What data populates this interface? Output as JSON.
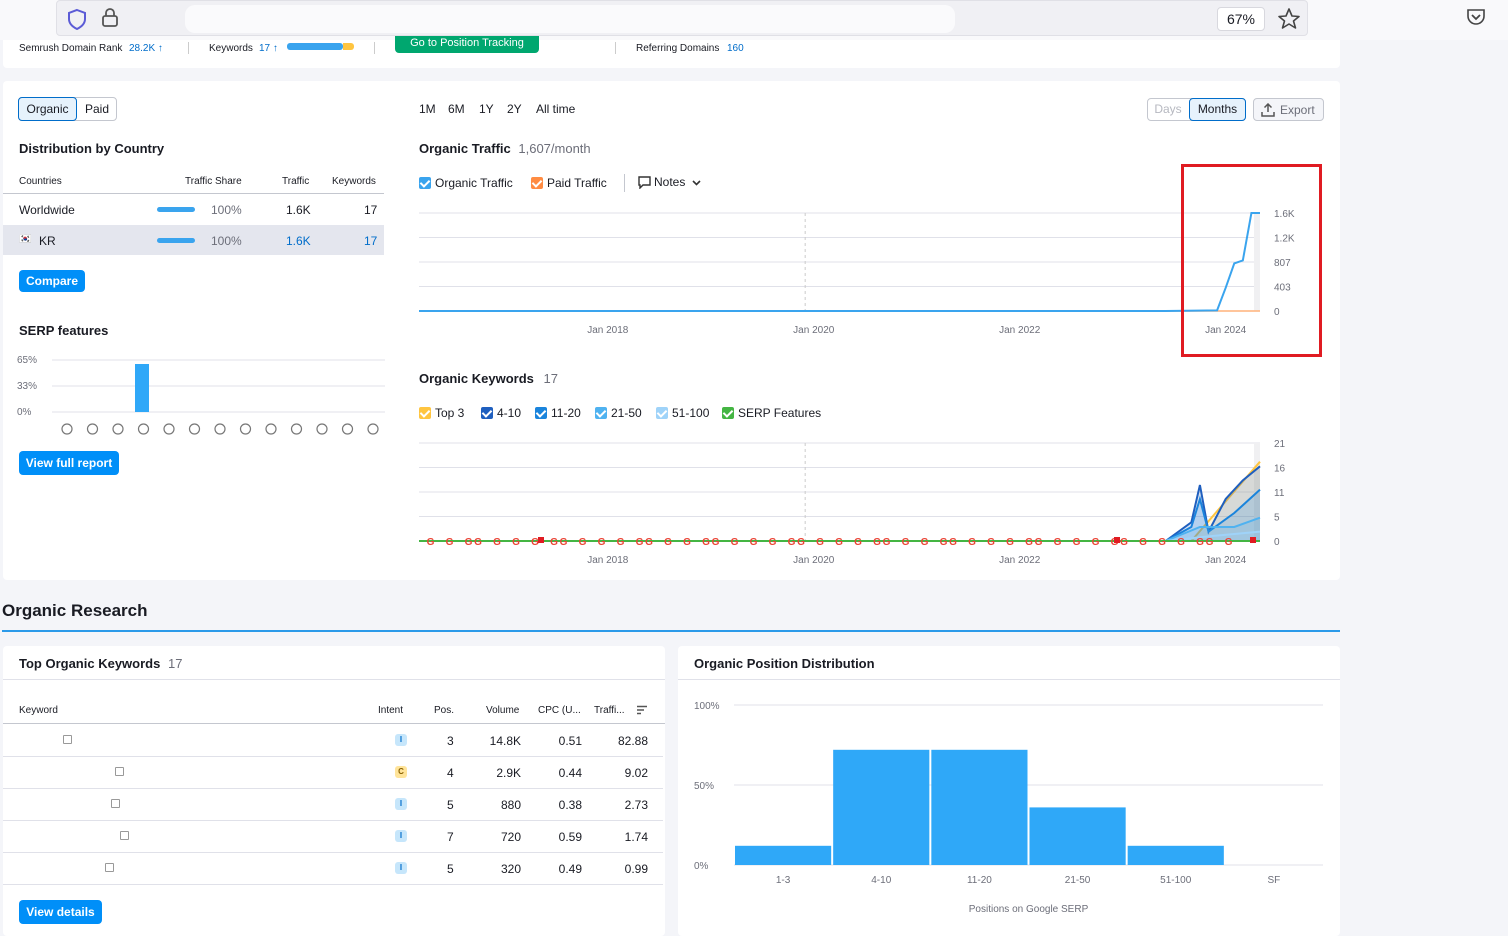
{
  "browser": {
    "zoom": "67%"
  },
  "topbar": {
    "domain_rank_label": "Semrush Domain Rank",
    "domain_rank_value": "28.2K ↑",
    "keywords_label": "Keywords",
    "keywords_value": "17 ↑",
    "tracking_button": "Go to Position Tracking",
    "ref_domains_label": "Referring Domains",
    "ref_domains_value": "160"
  },
  "toggle": {
    "organic": "Organic",
    "paid": "Paid"
  },
  "distribution": {
    "title": "Distribution by Country",
    "headers": [
      "Countries",
      "Traffic Share",
      "Traffic",
      "Keywords"
    ],
    "rows": [
      {
        "country": "Worldwide",
        "share": "100%",
        "share_value": 1.0,
        "traffic": "1.6K",
        "keywords": "17"
      },
      {
        "country": "KR",
        "flag": "🇰🇷",
        "share": "100%",
        "share_value": 1.0,
        "traffic": "1.6K",
        "keywords": "17"
      }
    ],
    "compare_button": "Compare"
  },
  "serp": {
    "title": "SERP features",
    "y_ticks": [
      "65%",
      "33%",
      "0%"
    ],
    "values": [
      0,
      0,
      0,
      60,
      0,
      0,
      0,
      0,
      0,
      0,
      0,
      0,
      0
    ],
    "icons": [
      "crown-icon",
      "link-icon",
      "star-icon",
      "image-icon",
      "play-icon",
      "video-icon",
      "play-circle-icon",
      "comment-icon",
      "pin-icon",
      "graduation-icon",
      "news-icon",
      "briefcase-icon",
      "x-icon"
    ],
    "button": "View full report"
  },
  "periods": [
    "1M",
    "6M",
    "1Y",
    "2Y",
    "All time"
  ],
  "active_period": "All time",
  "granularity": {
    "days": "Days",
    "months": "Months"
  },
  "export_label": "Export",
  "traffic": {
    "title": "Organic Traffic",
    "value": "1,607/month",
    "legend": [
      {
        "label": "Organic Traffic",
        "color": "#3aa4ee"
      },
      {
        "label": "Paid Traffic",
        "color": "#ff8c43"
      }
    ],
    "notes_label": "Notes"
  },
  "keywords_section": {
    "title": "Organic Keywords",
    "value": "17",
    "legend": [
      {
        "label": "Top 3",
        "color": "#ffc540"
      },
      {
        "label": "4-10",
        "color": "#1f5fbf"
      },
      {
        "label": "11-20",
        "color": "#1a84dc"
      },
      {
        "label": "21-50",
        "color": "#4fb2f0"
      },
      {
        "label": "51-100",
        "color": "#9fd3f9"
      },
      {
        "label": "SERP Features",
        "color": "#44b543"
      }
    ]
  },
  "chart_data": [
    {
      "type": "line",
      "title": "Organic Traffic",
      "x_ticks": [
        "Jan 2018",
        "Jan 2020",
        "Jan 2022",
        "Jan 2024"
      ],
      "y_ticks": [
        "1.6K",
        "1.2K",
        "807",
        "403",
        "0"
      ],
      "ylim": [
        0,
        1607
      ],
      "series": [
        {
          "name": "Organic Traffic",
          "points": [
            [
              "2016-03",
              0
            ],
            [
              "2023-06",
              0
            ],
            [
              "2023-12",
              10
            ],
            [
              "2024-01",
              380
            ],
            [
              "2024-02",
              780
            ],
            [
              "2024-03",
              830
            ],
            [
              "2024-04",
              1607
            ],
            [
              "2024-05",
              1607
            ]
          ]
        },
        {
          "name": "Paid Traffic",
          "points": [
            [
              "2016-03",
              0
            ],
            [
              "2024-05",
              0
            ]
          ]
        }
      ]
    },
    {
      "type": "area",
      "title": "Organic Keywords",
      "x_ticks": [
        "Jan 2018",
        "Jan 2020",
        "Jan 2022",
        "Jan 2024"
      ],
      "y_ticks": [
        "21",
        "16",
        "11",
        "5",
        "0"
      ],
      "ylim": [
        0,
        21
      ],
      "series": [
        {
          "name": "Top 3",
          "points": [
            [
              "2023-09",
              0
            ],
            [
              "2024-05",
              17
            ]
          ]
        },
        {
          "name": "4-10",
          "points": [
            [
              "2023-06",
              0
            ],
            [
              "2023-09",
              4
            ],
            [
              "2023-10",
              12
            ],
            [
              "2023-11",
              2
            ],
            [
              "2024-01",
              9
            ],
            [
              "2024-03",
              13
            ],
            [
              "2024-05",
              16
            ]
          ]
        },
        {
          "name": "11-20",
          "points": [
            [
              "2023-06",
              0
            ],
            [
              "2023-09",
              3
            ],
            [
              "2023-10",
              9
            ],
            [
              "2023-11",
              2
            ],
            [
              "2024-02",
              6
            ],
            [
              "2024-05",
              11
            ]
          ]
        },
        {
          "name": "21-50",
          "points": [
            [
              "2023-06",
              0
            ],
            [
              "2023-10",
              3
            ],
            [
              "2024-02",
              3
            ],
            [
              "2024-05",
              5
            ]
          ]
        },
        {
          "name": "51-100",
          "points": [
            [
              "2023-06",
              0
            ],
            [
              "2023-11",
              1
            ],
            [
              "2024-05",
              2
            ]
          ]
        }
      ]
    },
    {
      "type": "bar",
      "title": "Organic Position Distribution",
      "categories": [
        "1-3",
        "4-10",
        "11-20",
        "21-50",
        "51-100",
        "SF"
      ],
      "values": [
        12,
        72,
        72,
        36,
        12,
        0
      ],
      "y_ticks": [
        "100%",
        "50%",
        "0%"
      ],
      "ylim": [
        0,
        100
      ],
      "xlabel": "Positions on Google SERP"
    }
  ],
  "research": {
    "title": "Organic Research"
  },
  "top_keywords": {
    "title": "Top Organic Keywords",
    "count": "17",
    "headers": [
      "Keyword",
      "Intent",
      "Pos.",
      "Volume",
      "CPC (U...",
      "Traffi..."
    ],
    "rows": [
      {
        "intent": "I",
        "pos": "3",
        "volume": "14.8K",
        "cpc": "0.51",
        "traffic": "82.88"
      },
      {
        "intent": "C",
        "pos": "4",
        "volume": "2.9K",
        "cpc": "0.44",
        "traffic": "9.02"
      },
      {
        "intent": "I",
        "pos": "5",
        "volume": "880",
        "cpc": "0.38",
        "traffic": "2.73"
      },
      {
        "intent": "I",
        "pos": "7",
        "volume": "720",
        "cpc": "0.59",
        "traffic": "1.74"
      },
      {
        "intent": "I",
        "pos": "5",
        "volume": "320",
        "cpc": "0.49",
        "traffic": "0.99"
      }
    ],
    "button": "View details"
  },
  "position_dist": {
    "title": "Organic Position Distribution"
  }
}
